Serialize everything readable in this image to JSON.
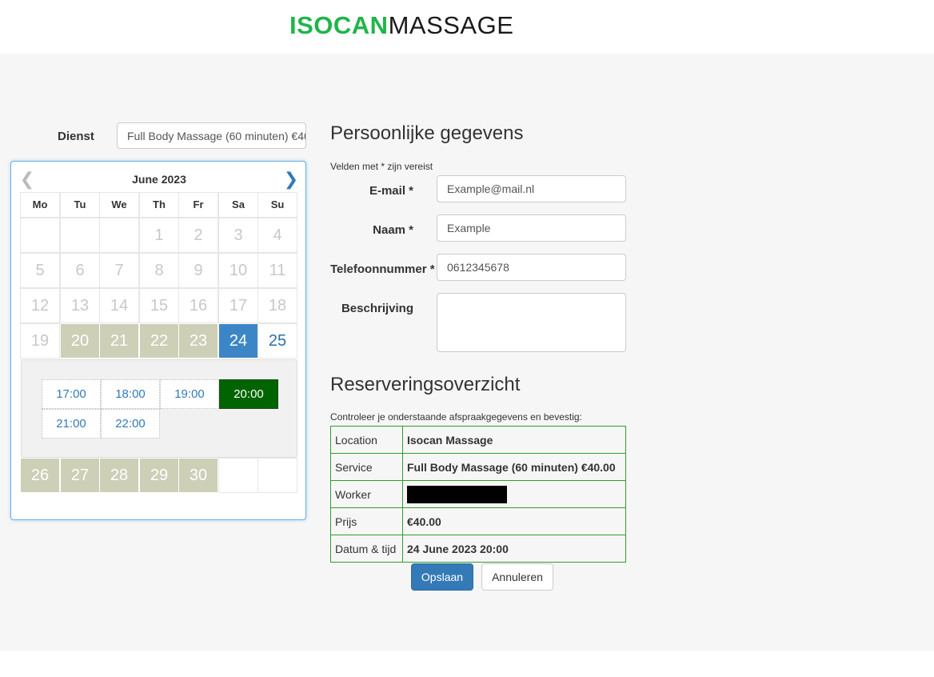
{
  "header": {
    "brand": "ISOCAN",
    "brand_rest": "MASSAGE"
  },
  "service": {
    "label": "Dienst",
    "selected": "Full Body Massage (60 minuten) €40.00"
  },
  "calendar": {
    "month_title": "June 2023",
    "weekdays": [
      "Mo",
      "Tu",
      "We",
      "Th",
      "Fr",
      "Sa",
      "Su"
    ],
    "rows_before_slots": [
      [
        "",
        "",
        "",
        "1",
        "2",
        "3",
        "4"
      ],
      [
        "5",
        "6",
        "7",
        "8",
        "9",
        "10",
        "11"
      ],
      [
        "12",
        "13",
        "14",
        "15",
        "16",
        "17",
        "18"
      ],
      [
        "19",
        "20",
        "21",
        "22",
        "23",
        "24",
        "25"
      ]
    ],
    "rows_after_slots": [
      [
        "26",
        "27",
        "28",
        "29",
        "30",
        "",
        ""
      ]
    ],
    "available_days": [
      "20",
      "21",
      "22",
      "23",
      "26",
      "27",
      "28",
      "29",
      "30"
    ],
    "selected_day": "24",
    "time_slots": [
      "17:00",
      "18:00",
      "19:00",
      "20:00",
      "21:00",
      "22:00"
    ],
    "selected_time": "20:00"
  },
  "personal": {
    "title": "Persoonlijke gegevens",
    "required_note": "Velden met * zijn vereist",
    "email_label": "E-mail *",
    "email_value": "Example@mail.nl",
    "name_label": "Naam *",
    "name_value": "Example",
    "phone_label": "Telefoonnummer *",
    "phone_value": "0612345678",
    "description_label": "Beschrijving",
    "description_value": ""
  },
  "overview": {
    "title": "Reserveringsoverzicht",
    "note": "Controleer je onderstaande afspraakgegevens en bevestig:",
    "rows": [
      {
        "key": "Location",
        "value": "Isocan Massage"
      },
      {
        "key": "Service",
        "value": "Full Body Massage (60 minuten) €40.00"
      },
      {
        "key": "Worker",
        "value": ""
      },
      {
        "key": "Prijs",
        "value": "€40.00"
      },
      {
        "key": "Datum & tijd",
        "value": "24 June 2023 20:00"
      }
    ]
  },
  "actions": {
    "save_label": "Opslaan",
    "cancel_label": "Annuleren"
  },
  "colors": {
    "brand_green": "#1fb54a",
    "available_day": "#cdcfb7",
    "selected_day": "#3c86c8",
    "selected_slot": "#006400",
    "primary_button": "#337ab7",
    "table_border": "#2e9e2e"
  }
}
